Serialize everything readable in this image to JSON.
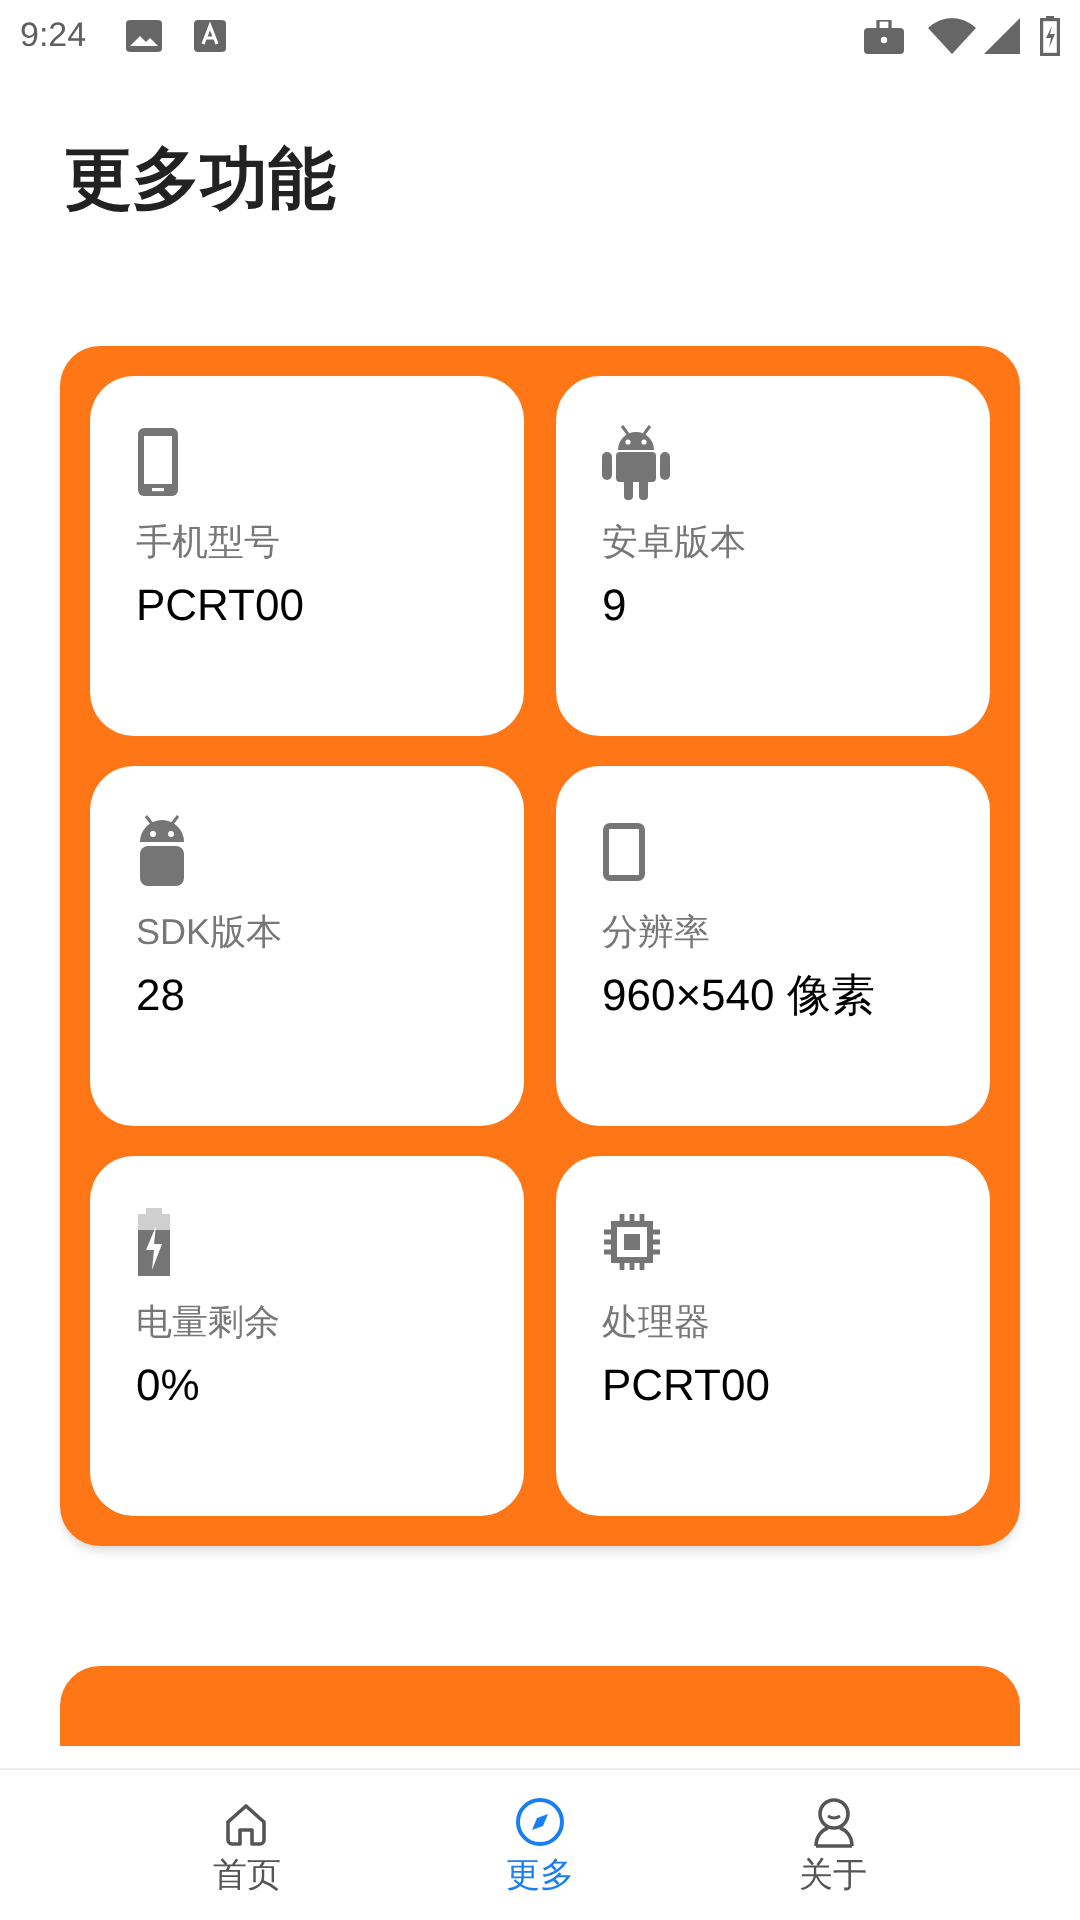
{
  "status_bar": {
    "time": "9:24"
  },
  "title": "更多功能",
  "info_cards": [
    {
      "label": "手机型号",
      "value": "PCRT00"
    },
    {
      "label": "安卓版本",
      "value": "9"
    },
    {
      "label": "SDK版本",
      "value": "28"
    },
    {
      "label": "分辨率",
      "value": "960×540 像素"
    },
    {
      "label": "电量剩余",
      "value": "0%"
    },
    {
      "label": "处理器",
      "value": "PCRT00"
    }
  ],
  "bottom_nav": [
    {
      "label": "首页",
      "selected": false
    },
    {
      "label": "更多",
      "selected": true
    },
    {
      "label": "关于",
      "selected": false
    }
  ]
}
